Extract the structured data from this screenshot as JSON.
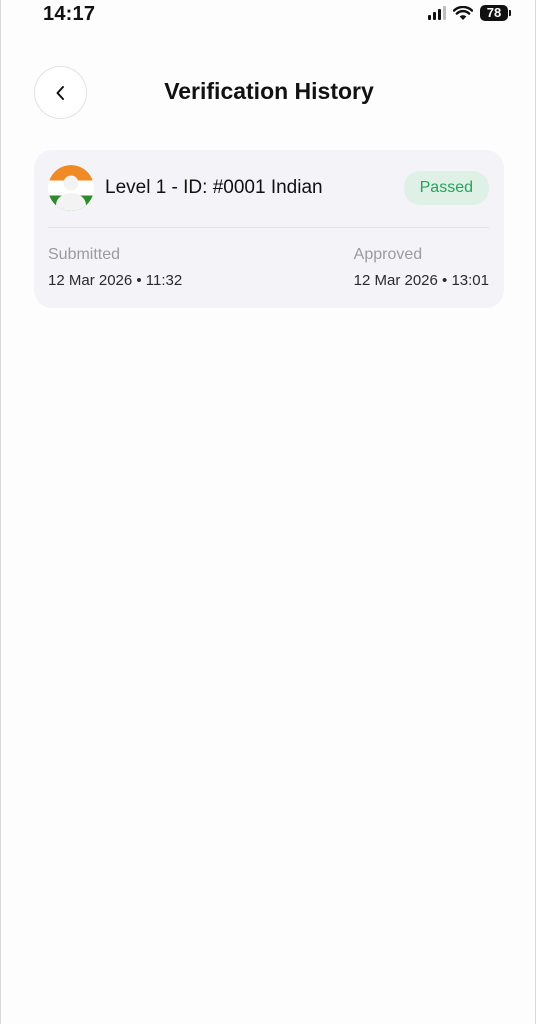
{
  "status_bar": {
    "time": "14:17",
    "battery": "78",
    "icons": [
      "signal-icon",
      "wifi-icon",
      "battery-icon"
    ]
  },
  "header": {
    "back_icon": "chevron-left-icon",
    "title": "Verification History"
  },
  "history": [
    {
      "avatar_icon": "india-flag-icon",
      "title": "Level 1 - ID: #0001 Indian",
      "status": "Passed",
      "status_color": "#23a45a",
      "submitted_label": "Submitted",
      "submitted_value": "12 Mar 2026 • 11:32",
      "approved_label": "Approved",
      "approved_value": "12 Mar 2026 • 13:01"
    }
  ]
}
